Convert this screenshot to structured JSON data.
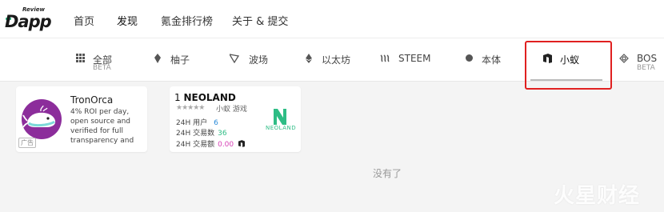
{
  "logo": {
    "small": "Review",
    "main": "Dapp"
  },
  "nav": {
    "items": [
      {
        "label": "首页"
      },
      {
        "label": "发现"
      },
      {
        "label": "氪金排行榜"
      },
      {
        "label": "关于 & 提交"
      }
    ],
    "active": "发现"
  },
  "categories": [
    {
      "label": "全部",
      "sub": "BETA",
      "icon": "grid-icon"
    },
    {
      "label": "柚子",
      "sub": "",
      "icon": "eos-icon"
    },
    {
      "label": "波场",
      "sub": "",
      "icon": "tron-icon"
    },
    {
      "label": "以太坊",
      "sub": "",
      "icon": "ethereum-icon"
    },
    {
      "label": "STEEM",
      "sub": "",
      "icon": "steem-icon"
    },
    {
      "label": "本体",
      "sub": "",
      "icon": "ontology-icon"
    },
    {
      "label": "小蚁",
      "sub": "",
      "icon": "neo-icon"
    },
    {
      "label": "BOS",
      "sub": "BETA",
      "icon": "bos-icon"
    }
  ],
  "selected_category": "小蚁",
  "ad_card": {
    "title": "TronOrca",
    "description": "4% ROI per day, open source and verified for full transparency and",
    "tag": "广告"
  },
  "app_card": {
    "rank": "1",
    "name": "NEOLAND",
    "stars": "★★★★★",
    "meta": "小蚁 游戏",
    "stats": [
      {
        "label": "24H 用户",
        "value": "6"
      },
      {
        "label": "24H 交易数",
        "value": "36"
      },
      {
        "label": "24H 交易额",
        "value": "0.00"
      }
    ],
    "logo_text": "NEOLAND"
  },
  "empty_text": "没有了",
  "watermark": "火星财经",
  "colors": {
    "highlight": "#e02020",
    "accent_green": "#2ebd85",
    "accent_blue": "#2a8ad8",
    "accent_pink": "#d63fb5",
    "orca_purple": "#8c2d9b"
  }
}
